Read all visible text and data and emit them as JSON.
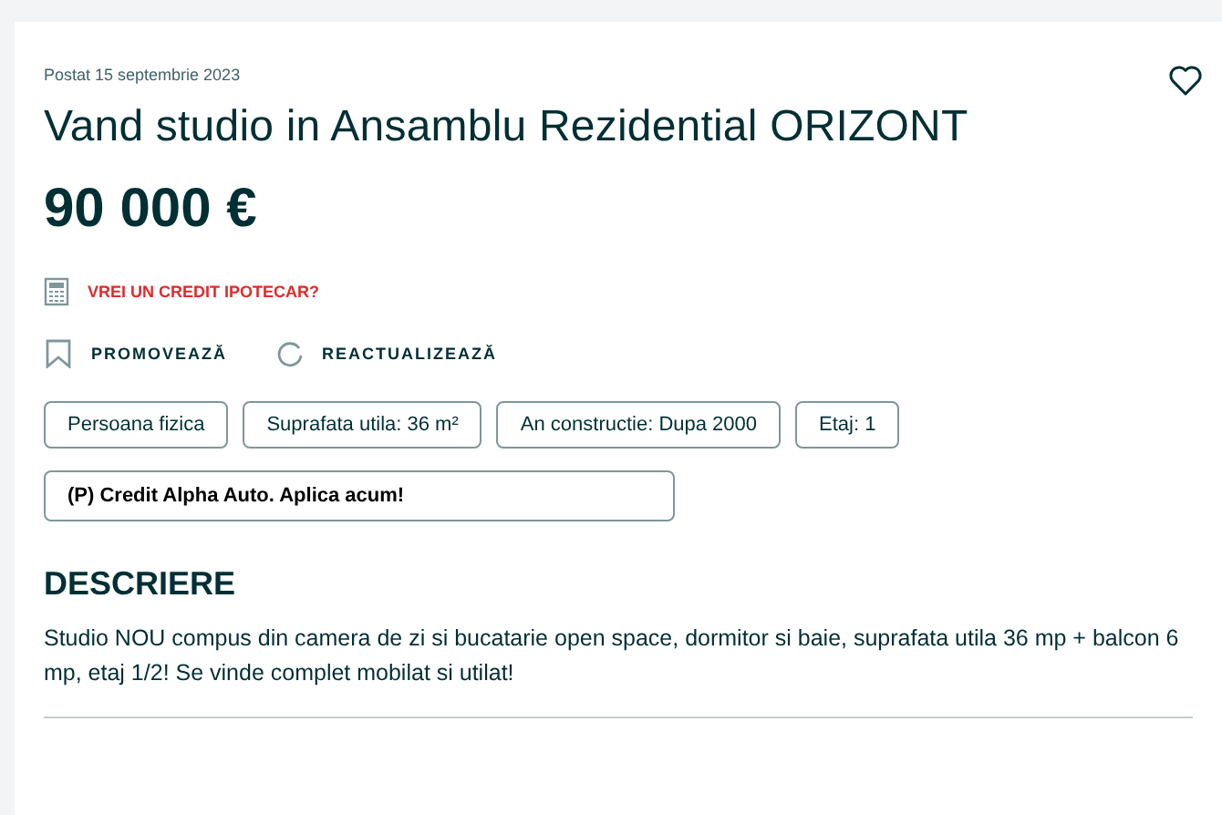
{
  "posted": "Postat 15 septembrie 2023",
  "title": "Vand studio in Ansamblu Rezidential ORIZONT",
  "price": "90 000 €",
  "credit_link": "VREI UN CREDIT IPOTECAR?",
  "actions": [
    {
      "kind": "promote",
      "label": "PROMOVEAZĂ"
    },
    {
      "kind": "refresh",
      "label": "REACTUALIZEAZĂ"
    }
  ],
  "tags": [
    "Persoana fizica",
    "Suprafata utila: 36 m²",
    "An constructie: Dupa 2000",
    "Etaj: 1"
  ],
  "ad_banner": "(P) Credit Alpha Auto. Aplica acum!",
  "description": {
    "heading": "DESCRIERE",
    "text": "Studio NOU compus din camera de zi si bucatarie open space, dormitor si baie, suprafata utila 36 mp + balcon 6 mp, etaj 1/2! Se vinde complet mobilat si utilat!"
  }
}
